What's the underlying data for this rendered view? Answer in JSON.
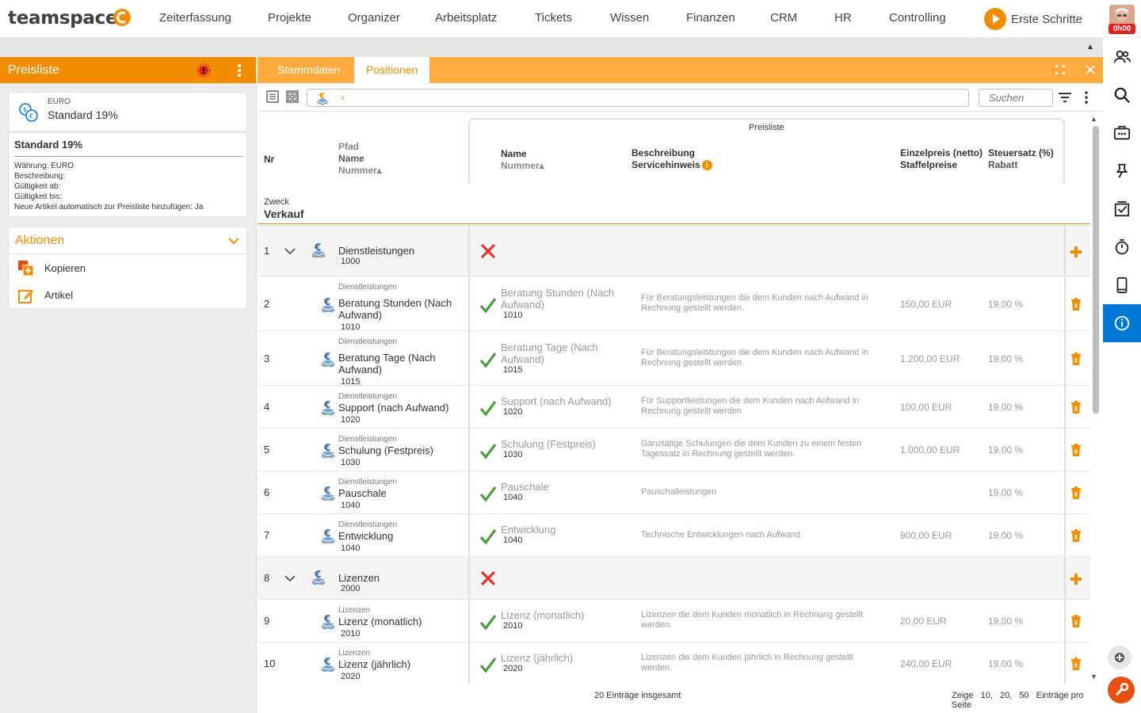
{
  "app": {
    "logo": "teamspace"
  },
  "nav": {
    "items": [
      "Zeiterfassung",
      "Projekte",
      "Organizer",
      "Arbeitsplatz",
      "Tickets",
      "Wissen",
      "Finanzen",
      "CRM",
      "HR",
      "Controlling"
    ],
    "erste_schritte": "Erste Schritte",
    "timer_badge": "0h00"
  },
  "left": {
    "title": "Preisliste",
    "currency": "EURO",
    "list_name": "Standard 19%",
    "details_title": "Standard 19%",
    "details": [
      "Währung: EURO",
      "Beschreibung:",
      "Gültigkeit ab:",
      "Gültigkeit bis:",
      "Neue Artikel automatisch zur Preisliste hinzufügen: Ja"
    ],
    "actions_title": "Aktionen",
    "actions": [
      "Kopieren",
      "Artikel"
    ]
  },
  "tabs": {
    "stammdaten": "Stammdaten",
    "positionen": "Positionen"
  },
  "search": {
    "placeholder": "Suchen"
  },
  "table": {
    "preisliste_label": "Preisliste",
    "h_nr": "Nr",
    "h_pfad": "Pfad",
    "h_name": "Name",
    "h_nummer": "Nummer▴",
    "h_pl_name": "Name",
    "h_pl_nummer": "Nummer▴",
    "h_beschreibung": "Beschreibung",
    "h_servicehinweis": "Servicehinweis",
    "h_einzelpreis": "Einzelpreis (netto)",
    "h_staffelpreise": "Staffelpreise",
    "h_steuersatz": "Steuersatz (%)",
    "h_rabatt": "Rabatt",
    "zweck_label": "Zweck",
    "zweck_value": "Verkauf",
    "rows": [
      {
        "nr": "1",
        "group": true,
        "path": "",
        "name": "Dienstleistungen",
        "num": "1000",
        "included": false,
        "pname": "",
        "pnum": "",
        "desc": "",
        "price": "",
        "tax": ""
      },
      {
        "nr": "2",
        "group": false,
        "path": "Dienstleistungen",
        "name": "Beratung Stunden (Nach Aufwand)",
        "num": "1010",
        "included": true,
        "pname": "Beratung Stunden (Nach Aufwand)",
        "pnum": "1010",
        "desc": "Für Beratungsleistungen die dem Kunden nach Aufwand in Rechnung gestellt werden.",
        "price": "150,00 EUR",
        "tax": "19,00 %"
      },
      {
        "nr": "3",
        "group": false,
        "path": "Dienstleistungen",
        "name": "Beratung Tage (Nach Aufwand)",
        "num": "1015",
        "included": true,
        "pname": "Beratung Tage (Nach Aufwand)",
        "pnum": "1015",
        "desc": "Für Beratungsleistungen die dem Kunden nach Aufwand in Rechnung gestellt werden.",
        "price": "1.200,00 EUR",
        "tax": "19,00 %"
      },
      {
        "nr": "4",
        "group": false,
        "path": "Dienstleistungen",
        "name": "Support (nach Aufwand)",
        "num": "1020",
        "included": true,
        "pname": "Support (nach Aufwand)",
        "pnum": "1020",
        "desc": "Für Supportleistungen die dem Kunden nach Aufwand in Rechnung gestellt werden",
        "price": "100,00 EUR",
        "tax": "19,00 %"
      },
      {
        "nr": "5",
        "group": false,
        "path": "Dienstleistungen",
        "name": "Schulung (Festpreis)",
        "num": "1030",
        "included": true,
        "pname": "Schulung (Festpreis)",
        "pnum": "1030",
        "desc": "Ganztätige Schulungen die dem Kunden zu einem festen Tagessatz in Rechnung gestellt werden.",
        "price": "1.000,00 EUR",
        "tax": "19,00 %"
      },
      {
        "nr": "6",
        "group": false,
        "path": "Dienstleistungen",
        "name": "Pauschale",
        "num": "1040",
        "included": true,
        "pname": "Pauschale",
        "pnum": "1040",
        "desc": "Pauschalleistungen",
        "price": "",
        "tax": "19,00 %"
      },
      {
        "nr": "7",
        "group": false,
        "path": "Dienstleistungen",
        "name": "Entwicklung",
        "num": "1040",
        "included": true,
        "pname": "Entwicklung",
        "pnum": "1040",
        "desc": "Technische Entwicklungen nach Aufwand",
        "price": "900,00 EUR",
        "tax": "19,00 %"
      },
      {
        "nr": "8",
        "group": true,
        "path": "",
        "name": "Lizenzen",
        "num": "2000",
        "included": false,
        "pname": "",
        "pnum": "",
        "desc": "",
        "price": "",
        "tax": ""
      },
      {
        "nr": "9",
        "group": false,
        "path": "Lizenzen",
        "name": "Lizenz (monatlich)",
        "num": "2010",
        "included": true,
        "pname": "Lizenz (monatlich)",
        "pnum": "2010",
        "desc": "Lizenzen die dem Kunden monatlich in Rechnung gestellt werden.",
        "price": "20,00 EUR",
        "tax": "19,00 %"
      },
      {
        "nr": "10",
        "group": false,
        "path": "Lizenzen",
        "name": "Lizenz (jährlich)",
        "num": "2020",
        "included": true,
        "pname": "Lizenz (jährlich)",
        "pnum": "2020",
        "desc": "Lizenzen die dem Kunden jährlich in Rechnung gestellt werden.",
        "price": "240,00 EUR",
        "tax": "19,00 %"
      }
    ]
  },
  "footer": {
    "total": "20 Einträge insgesamt",
    "show": "Zeige",
    "sizes": [
      "10,",
      "20,",
      "50"
    ],
    "per_page": "Einträge pro Seite"
  },
  "colors": {
    "accent": "#f28c00",
    "tab_bar": "#ffaa3d",
    "info_active": "#0078d4",
    "check": "#4a9e3e",
    "cross": "#e0362c"
  }
}
